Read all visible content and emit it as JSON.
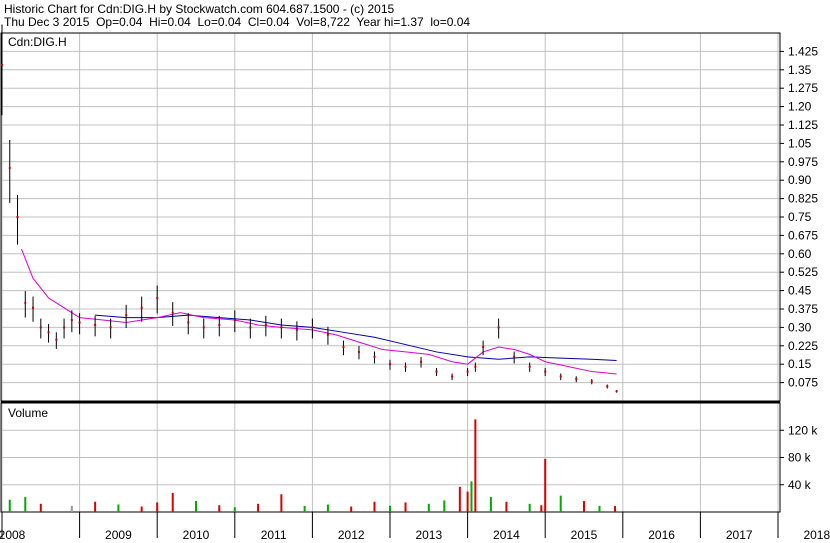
{
  "header": {
    "title_line": "Historic Chart for Cdn:DIG.H by Stockwatch.com 604.687.1500 - (c) 2015",
    "date": "Thu Dec  3 2015",
    "open": "Op=0.04",
    "high": "Hi=0.04",
    "low": "Lo=0.04",
    "close": "Cl=0.04",
    "volume": "Vol=8,722",
    "year_high": "Year hi=1.37",
    "year_low": "lo=0.04"
  },
  "price_panel": {
    "symbol_label": "Cdn:DIG.H"
  },
  "volume_panel": {
    "label": "Volume"
  },
  "colors": {
    "price_bar": "#000000",
    "price_dot": "#cc0000",
    "ma_long": "#0000aa",
    "ma_short": "#dd00dd",
    "grid": "#c0c0c0",
    "vol_up": "#00aa00",
    "vol_down": "#dd0000",
    "vol_flat": "#999999"
  },
  "chart_data": [
    {
      "type": "line",
      "title": "Cdn:DIG.H",
      "x_labels": [
        "2008",
        "2009",
        "2010",
        "2011",
        "2012",
        "2013",
        "2014",
        "2015",
        "2016",
        "2017",
        "2018"
      ],
      "y_ticks": [
        "1.425",
        "1.35",
        "1.275",
        "1.20",
        "1.125",
        "1.05",
        "0.975",
        "0.90",
        "0.825",
        "0.75",
        "0.675",
        "0.60",
        "0.525",
        "0.45",
        "0.375",
        "0.30",
        "0.225",
        "0.15",
        "0.075"
      ],
      "ylim": [
        0,
        1.5
      ],
      "grid": true,
      "series": [
        {
          "role": "price",
          "x": [
            2008.0,
            2008.1,
            2008.2,
            2008.3,
            2008.4,
            2008.5,
            2008.6,
            2008.7,
            2008.8,
            2008.9,
            2009.0,
            2009.2,
            2009.4,
            2009.6,
            2009.8,
            2010.0,
            2010.2,
            2010.4,
            2010.6,
            2010.8,
            2011.0,
            2011.2,
            2011.4,
            2011.6,
            2011.8,
            2012.0,
            2012.2,
            2012.4,
            2012.6,
            2012.8,
            2013.0,
            2013.2,
            2013.4,
            2013.6,
            2013.8,
            2014.0,
            2014.1,
            2014.2,
            2014.4,
            2014.6,
            2014.8,
            2015.0,
            2015.2,
            2015.4,
            2015.6,
            2015.8,
            2015.92
          ],
          "values": [
            1.37,
            0.95,
            0.75,
            0.4,
            0.38,
            0.3,
            0.28,
            0.25,
            0.3,
            0.33,
            0.32,
            0.31,
            0.3,
            0.35,
            0.38,
            0.42,
            0.36,
            0.32,
            0.3,
            0.31,
            0.33,
            0.3,
            0.31,
            0.3,
            0.29,
            0.3,
            0.27,
            0.22,
            0.2,
            0.18,
            0.15,
            0.14,
            0.16,
            0.12,
            0.1,
            0.12,
            0.14,
            0.22,
            0.3,
            0.18,
            0.14,
            0.12,
            0.1,
            0.09,
            0.08,
            0.06,
            0.04
          ]
        },
        {
          "role": "moving-average-long",
          "x": [
            2009.2,
            2009.6,
            2010.0,
            2010.4,
            2010.8,
            2011.2,
            2011.6,
            2012.0,
            2012.4,
            2012.8,
            2013.2,
            2013.6,
            2014.0,
            2014.4,
            2014.8,
            2015.2,
            2015.6,
            2015.92
          ],
          "values": [
            0.35,
            0.34,
            0.34,
            0.35,
            0.34,
            0.33,
            0.31,
            0.3,
            0.28,
            0.26,
            0.23,
            0.2,
            0.18,
            0.17,
            0.18,
            0.175,
            0.17,
            0.165
          ]
        },
        {
          "role": "moving-average-short",
          "x": [
            2008.25,
            2008.4,
            2008.6,
            2008.8,
            2009.0,
            2009.3,
            2009.6,
            2010.0,
            2010.3,
            2010.6,
            2011.0,
            2011.3,
            2011.6,
            2012.0,
            2012.3,
            2012.6,
            2012.9,
            2013.2,
            2013.5,
            2013.8,
            2014.0,
            2014.2,
            2014.4,
            2014.6,
            2014.8,
            2015.0,
            2015.3,
            2015.6,
            2015.92
          ],
          "values": [
            0.62,
            0.5,
            0.42,
            0.38,
            0.34,
            0.33,
            0.32,
            0.34,
            0.36,
            0.34,
            0.33,
            0.31,
            0.3,
            0.29,
            0.27,
            0.24,
            0.21,
            0.2,
            0.19,
            0.16,
            0.15,
            0.2,
            0.22,
            0.21,
            0.19,
            0.16,
            0.14,
            0.12,
            0.11
          ]
        }
      ]
    },
    {
      "type": "bar",
      "title": "Volume",
      "y_ticks": [
        "120 k",
        "80 k",
        "40 k"
      ],
      "ylim": [
        0,
        160000
      ],
      "x": [
        2008.1,
        2008.3,
        2008.5,
        2008.9,
        2009.2,
        2009.5,
        2009.8,
        2010.0,
        2010.2,
        2010.5,
        2010.8,
        2011.0,
        2011.3,
        2011.6,
        2011.9,
        2012.2,
        2012.5,
        2012.8,
        2013.0,
        2013.2,
        2013.5,
        2013.7,
        2013.9,
        2014.0,
        2014.05,
        2014.1,
        2014.3,
        2014.5,
        2014.8,
        2014.95,
        2015.0,
        2015.2,
        2015.5,
        2015.7,
        2015.9
      ],
      "values": [
        18000,
        22000,
        12000,
        9000,
        15000,
        11000,
        8000,
        14000,
        28000,
        16000,
        10000,
        7000,
        12000,
        26000,
        9000,
        11000,
        8000,
        15000,
        9000,
        14000,
        12000,
        17000,
        37000,
        30000,
        45000,
        136000,
        22000,
        15000,
        12000,
        10000,
        78000,
        24000,
        16000,
        9000,
        8722
      ],
      "colors": [
        "vol_up",
        "vol_up",
        "vol_down",
        "vol_flat",
        "vol_down",
        "vol_up",
        "vol_down",
        "vol_down",
        "vol_down",
        "vol_up",
        "vol_down",
        "vol_up",
        "vol_down",
        "vol_down",
        "vol_up",
        "vol_up",
        "vol_down",
        "vol_down",
        "vol_up",
        "vol_down",
        "vol_up",
        "vol_up",
        "vol_down",
        "vol_down",
        "vol_up",
        "vol_down",
        "vol_up",
        "vol_down",
        "vol_up",
        "vol_down",
        "vol_down",
        "vol_up",
        "vol_down",
        "vol_up",
        "vol_down"
      ]
    }
  ]
}
